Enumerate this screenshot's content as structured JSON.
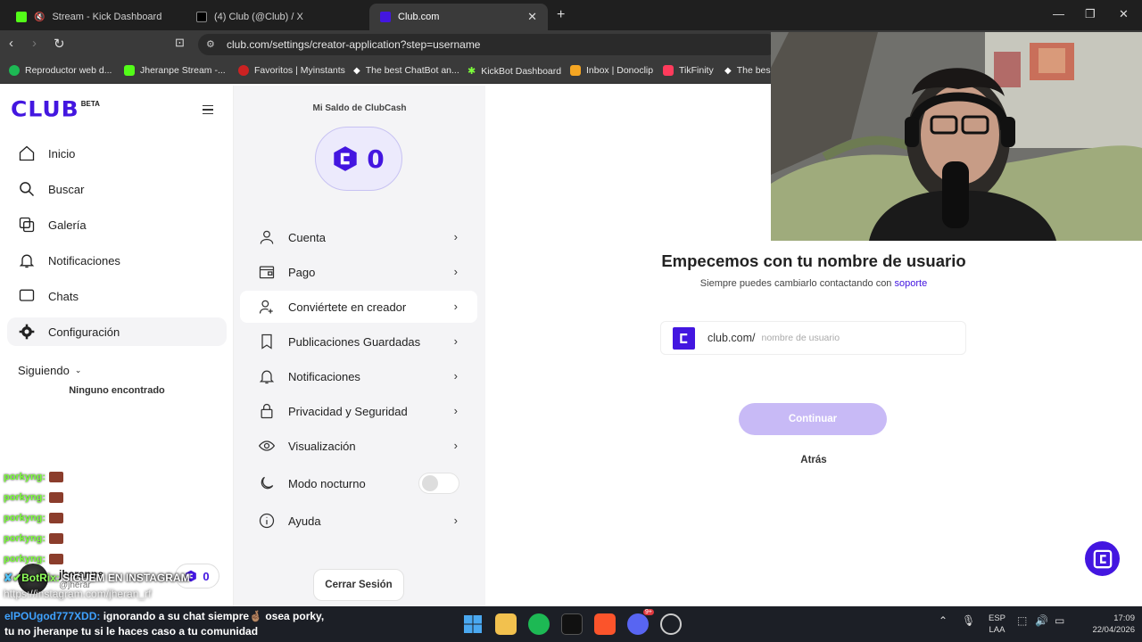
{
  "browser": {
    "tabs": [
      {
        "title": "Stream - Kick Dashboard",
        "favicon_color": "#53fc18",
        "active": false
      },
      {
        "title": "(4) Club (@Club) / X",
        "favicon_color": "#000000",
        "active": false
      },
      {
        "title": "Club.com",
        "favicon_color": "#4316e0",
        "active": true
      }
    ],
    "url": "club.com/settings/creator-application?step=username",
    "bookmarks": [
      {
        "label": "Reproductor web d...",
        "color": "#1db954"
      },
      {
        "label": "Jheranpe Stream -...",
        "color": "#53fc18"
      },
      {
        "label": "Favoritos | Myinstants",
        "color": "#cc2222"
      },
      {
        "label": "The best ChatBot an...",
        "color": "#ffffff"
      },
      {
        "label": "KickBot Dashboard",
        "color": "#7cff3a"
      },
      {
        "label": "Inbox | Donoclip",
        "color": "#f5a623"
      },
      {
        "label": "TikFinity",
        "color": "#ff3b5c"
      },
      {
        "label": "The bes",
        "color": "#ffffff"
      }
    ]
  },
  "sidebar": {
    "logo": "CLUB",
    "logo_badge": "BETA",
    "items": [
      {
        "label": "Inicio",
        "icon": "home-icon"
      },
      {
        "label": "Buscar",
        "icon": "search-icon"
      },
      {
        "label": "Galería",
        "icon": "gallery-icon"
      },
      {
        "label": "Notificaciones",
        "icon": "bell-icon"
      },
      {
        "label": "Chats",
        "icon": "chat-icon"
      },
      {
        "label": "Configuración",
        "icon": "gear-icon",
        "active": true
      }
    ],
    "following_label": "Siguiendo",
    "following_empty": "Ninguno encontrado",
    "profile_name": "jheranpe",
    "profile_sub": "@jherar",
    "profile_cash": "0"
  },
  "settings": {
    "balance_title": "Mi Saldo de ClubCash",
    "balance_value": "0",
    "rows": [
      {
        "label": "Cuenta",
        "icon": "user-icon"
      },
      {
        "label": "Pago",
        "icon": "wallet-icon"
      },
      {
        "label": "Conviértete en creador",
        "icon": "creator-icon",
        "active": true
      },
      {
        "label": "Publicaciones Guardadas",
        "icon": "bookmark-icon"
      },
      {
        "label": "Notificaciones",
        "icon": "bell-icon"
      },
      {
        "label": "Privacidad y Seguridad",
        "icon": "lock-icon"
      },
      {
        "label": "Visualización",
        "icon": "eye-icon"
      },
      {
        "label": "Modo nocturno",
        "icon": "moon-icon",
        "toggle": false
      },
      {
        "label": "Ayuda",
        "icon": "info-icon"
      }
    ],
    "logout_label": "Cerrar Sesión"
  },
  "main": {
    "title": "Empecemos con tu nombre de usuario",
    "subtitle": "Siempre puedes cambiarlo contactando con",
    "subtitle_link": "soporte",
    "prefix": "club.com/",
    "username_placeholder": "nombre de usuario",
    "username_value": "",
    "continue_label": "Continuar",
    "back_label": "Atrás"
  },
  "overlay": {
    "chat": [
      {
        "user": "porkyng:"
      },
      {
        "user": "porkyng:"
      },
      {
        "user": "porkyng:"
      },
      {
        "user": "porkyng:"
      },
      {
        "user": "porkyng:"
      }
    ],
    "bot_name": "BotRix:",
    "bot_message": "SIGUEM EN INSTAGRAM",
    "bot_link": "https://instagram.com/jheran_rf",
    "stream_msg_user": "elPOUgod777XDD:",
    "stream_msg_text_1": "ignorando a su chat siempre🤞🏽 osea porky,",
    "stream_msg_text_2": "tu no jheranpe tu si le haces caso a tu comunidad"
  },
  "taskbar": {
    "lang_1": "ESP",
    "lang_2": "LAA",
    "time": "17:09",
    "date": "22/04/2026",
    "discord_badge": "9+"
  },
  "colors": {
    "brand": "#4316e0",
    "continue_disabled": "#c8baf6"
  }
}
